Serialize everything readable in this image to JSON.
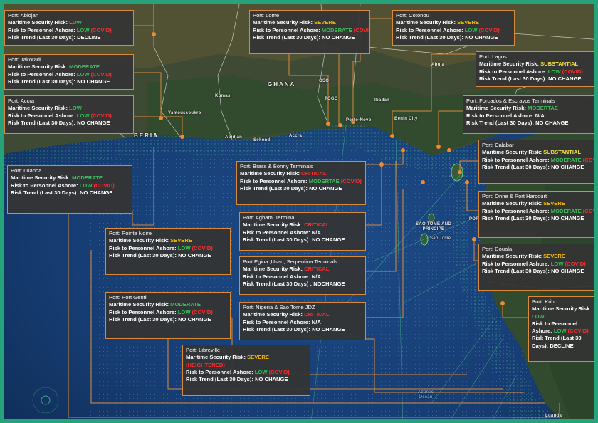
{
  "map_labels": {
    "country_ghana": "GHANA",
    "country_liberia": "BERIA",
    "island_sao_tome": "SAO TOME AND PRINCIPE",
    "island_sao_tome_city": "São Tomé",
    "ocean": "Atlantic Ocean",
    "city_porto_novo": "Porto-Novo",
    "city_ibadan": "Ibadan",
    "city_benin_city": "Benin City",
    "city_abuja": "Abuja",
    "city_oso": "OSO",
    "city_sekondi": "Sekondi",
    "city_yamoussoukro": "Yamoussoukro",
    "city_abidjan": "Abidjan",
    "city_accra": "Accra",
    "city_kumasi": "Kumasi",
    "city_luanda": "Luanda",
    "city_togo": "TOGO",
    "city_equatorial": "POR"
  },
  "colors": {
    "low": "#2ec24f",
    "moderate": "#3fbf5c",
    "severe": "#f2b705",
    "critical": "#ff2d2d",
    "substantial": "#f0e23a",
    "card_border": "#d98a3a",
    "frame": "#27a37c"
  },
  "ports": [
    {
      "id": "abidjan",
      "port": "Port: Abidjan",
      "sec_label": "Maritime Security Risk:",
      "sec": "LOW",
      "per_label": "Risk to Personnel Ashore:",
      "per": "LOW",
      "per_note": "(COVID)",
      "trend_label": "Risk Trend (Last 30 Days):",
      "trend": "DECLINE"
    },
    {
      "id": "lome",
      "port": "Port: Lomé",
      "sec_label": "Maritime Security Risk:",
      "sec": "SEVERE",
      "per_label": "Risk to Personnel Ashore:",
      "per": "MODERATE",
      "per_note": "(COVID)",
      "trend_label": "Risk Trend (Last 30 Days):",
      "trend": "NO CHANGE"
    },
    {
      "id": "cotonou",
      "port": "Port: Cotonou",
      "sec_label": "Maritime Security Risk:",
      "sec": "SEVERE",
      "per_label": "Risk to Personnel Ashore:",
      "per": "LOW",
      "per_note": "(COVID)",
      "trend_label": "Risk Trend (Last 30 Days):",
      "trend": "NO CHANGE"
    },
    {
      "id": "takoradi",
      "port": "Port: Takoradi",
      "sec_label": "Maritime Security Risk:",
      "sec": "MODERATE",
      "per_label": "Risk to Personnel Ashore:",
      "per": "LOW",
      "per_note": "(COVID)",
      "trend_label": "Risk Trend (Last 30 Days):",
      "trend": "NO CHANGE"
    },
    {
      "id": "lagos",
      "port": "Port: Lagos",
      "sec_label": "Maritime Security Risk:",
      "sec": "SUBSTANTIAL",
      "per_label": "Risk to Personnel Ashore:",
      "per": "LOW",
      "per_note": "(COVID)",
      "trend_label": "Risk Trend (Last 30 Days):",
      "trend": "NO CHANGE"
    },
    {
      "id": "accra",
      "port": "Port: Accra",
      "sec_label": "Maritime Security Risk:",
      "sec": "LOW",
      "per_label": "Risk to Personnel Ashore:",
      "per": "LOW",
      "per_note": "(COVID)",
      "trend_label": "Risk Trend (Last 30 Days):",
      "trend": "NO CHANGE"
    },
    {
      "id": "forcados",
      "port": "Port: Forcados & Escravos Terminals",
      "sec_label": "Maritime Security Risk:",
      "sec": "MODERTAE",
      "per_label": "Risk to Personnel Ashore:",
      "per": "N/A",
      "per_note": "",
      "trend_label": "Risk Trend (Last 30 Days):",
      "trend": "NO CHANGE"
    },
    {
      "id": "calabar",
      "port": "Port: Calabar",
      "sec_label": "Maritime Security Risk:",
      "sec": "SUBSTANTIAL",
      "per_label": "Risk to Personnel Ashore:",
      "per": "MODERATE",
      "per_note": "(COVID)",
      "trend_label": "Risk Trend (Last 30 Days):",
      "trend": "NO CHANGE"
    },
    {
      "id": "luanda",
      "port": "Port: Luanda",
      "sec_label": "Maritime Security Risk:",
      "sec": "MODERATE",
      "per_label": "Risk to Personnel Ashore:",
      "per": "LOW",
      "per_note": "(COVID)",
      "trend_label": "Risk Trend (Last 30 Days):",
      "trend": "NO CHANGE"
    },
    {
      "id": "brass",
      "port": "Port: Brass & Bonny Terminals",
      "sec_label": "Maritime Security Risk:",
      "sec": "CRITICAL",
      "per_label": "Risk to Personnel Ashore:",
      "per": "MODERTAE",
      "per_note": "(COVID)",
      "trend_label": "Risk Trend (Last 30 Days):",
      "trend": "NO CHANGE"
    },
    {
      "id": "onne",
      "port": "Port: Onne & Port Harcourt",
      "sec_label": "Maritime Security Risk:",
      "sec": "SEVERE",
      "per_label": "Risk to Personnel Ashore:",
      "per": "MODERATE",
      "per_note": "(COVID)",
      "trend_label": "Risk Trend (Last 30 Days):",
      "trend": "NO CHANGE"
    },
    {
      "id": "agbami",
      "port": "Port: Agbami Terminal",
      "sec_label": "Maritime Security Risk:",
      "sec": "CRITICAL",
      "per_label": "Risk to Personnel Ashore:",
      "per": "N/A",
      "per_note": "",
      "trend_label": "Risk Trend (Last 30 Days):",
      "trend": "NO CHANGE"
    },
    {
      "id": "pointe",
      "port": "Port: Pointe Noire",
      "sec_label": "Maritime Security Risk:",
      "sec": "SEVERE",
      "per_label": "Risk to Personnel Ashore:",
      "per": "LOW",
      "per_note": "(COVID)",
      "trend_label": "Risk Trend (Last 30 Days):",
      "trend": "NO CHANGE"
    },
    {
      "id": "douala",
      "port": "Port: Douala",
      "sec_label": "Maritime Security Risk:",
      "sec": "SEVERE",
      "per_label": "Risk to Personnel Ashore:",
      "per": "LOW",
      "per_note": "(COVID)",
      "trend_label": "Risk Trend (Last 30 Days):",
      "trend": "NO CHANGE"
    },
    {
      "id": "egina",
      "port": "Port:Egina ,Usan, Serpentina Terminals",
      "sec_label": "Maritime Security Risk:",
      "sec": "CRITICAL",
      "per_label": "Risk to Personnel Ashore:",
      "per": "N/A",
      "per_note": "",
      "trend_label": "Risk Trend (Last 30 Days) :",
      "trend": "NOCHANGE"
    },
    {
      "id": "gentil",
      "port": "Port: Port Gentil",
      "sec_label": "Maritime Security Risk:",
      "sec": "MODERATE",
      "per_label": "Risk to Personnel Ashore:",
      "per": "LOW",
      "per_note": "(COVID)",
      "trend_label": "Risk Trend (Last 30 Days):",
      "trend": "NO CHANGE"
    },
    {
      "id": "jdz",
      "port": "Port: Nigeria & Sao Tome JDZ",
      "sec_label": "Maritime Security Risk:",
      "sec": "CRITICAL",
      "per_label": "Risk to Personnel Ashore:",
      "per": "N/A",
      "per_note": "",
      "trend_label": "Risk Trend (Last 30 Days):",
      "trend": "NO CHANGE"
    },
    {
      "id": "kribi",
      "port": "Port: Kribi",
      "sec_label": "Maritime Security Risk:",
      "sec": "LOW",
      "per_label": "Risk to Personnel Ashore:",
      "per": "LOW",
      "per_note": "(COVID)",
      "trend_label": "Risk Trend (Last 30 Days):",
      "trend": "DECLINE"
    },
    {
      "id": "libreville",
      "port": "Port: Libreville",
      "sec_label": "Maritime Security Risk:",
      "sec": "SEVERE",
      "sec_note": "(HEIGHTENED)",
      "per_label": "Risk to Personnel Ashore:",
      "per": "LOW",
      "per_note": "(COVID)",
      "trend_label": "Risk Trend (Last 30 Days):",
      "trend": "NO CHANGE"
    }
  ]
}
